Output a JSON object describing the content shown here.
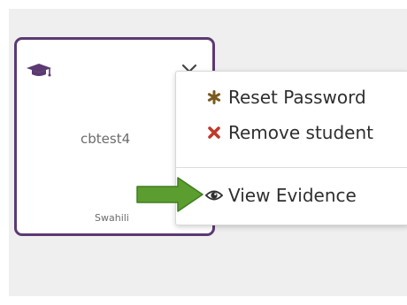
{
  "card": {
    "username": "cbtest4",
    "language": "Swahili",
    "accent_color": "#5b3a72",
    "role_icon": "graduation-cap-icon",
    "menu_toggle_icon": "chevron-down-icon"
  },
  "menu": {
    "items": [
      {
        "label": "Reset Password",
        "icon": "asterisk-icon",
        "icon_color": "#7a5a1e"
      },
      {
        "label": "Remove student",
        "icon": "x-icon",
        "icon_color": "#c0392b"
      },
      {
        "label": "View Evidence",
        "icon": "eye-icon",
        "icon_color": "#2f2f2f"
      }
    ]
  },
  "annotation": {
    "arrow_icon": "right-arrow-icon",
    "arrow_color": "#5b9e2f"
  }
}
